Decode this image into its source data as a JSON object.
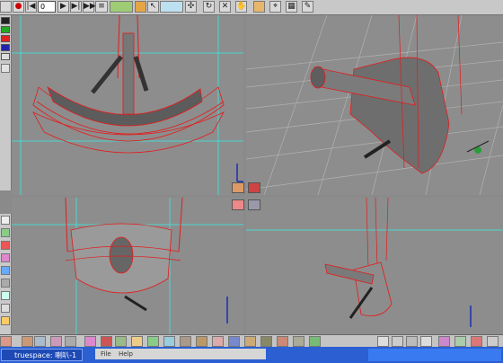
{
  "toolbar": {
    "frame_value": "0",
    "icons": [
      "record-icon",
      "rewind-icon",
      "play-icon",
      "forward-icon",
      "end-icon",
      "object-tool-icon",
      "paint-icon",
      "select-icon",
      "move-icon",
      "rotate-icon",
      "scale-icon",
      "scene-icon"
    ]
  },
  "colors": {
    "wire_red": "#e51b1b",
    "guide_cyan": "#49d7d0",
    "grid_light": "#b2b2b2",
    "model_gray": "#6b6b6b",
    "taskbar_blue": "#2b5fd2"
  },
  "taskbar": {
    "task_label": "truespace: 喇叭-1",
    "menu_items": [
      "File",
      "Help"
    ]
  }
}
